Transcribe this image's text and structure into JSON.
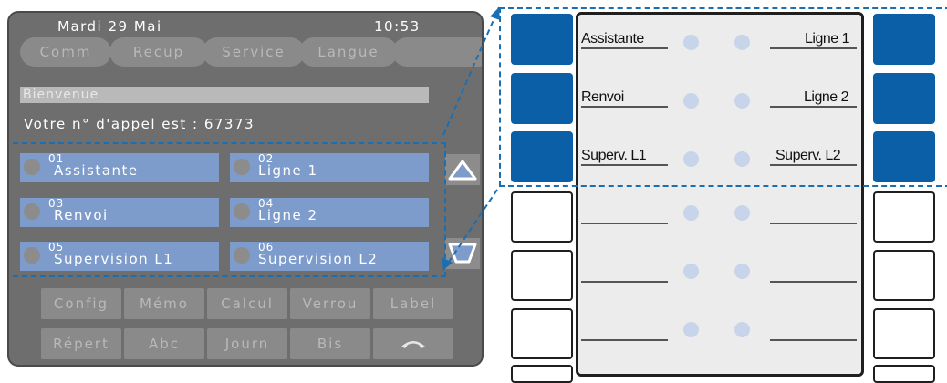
{
  "header": {
    "date": "Mardi 29 Mai",
    "time": "10:53"
  },
  "softkeys": [
    "Comm",
    "Recup",
    "Service",
    "Langue",
    ""
  ],
  "welcome": "Bienvenue",
  "call_number_text": "Votre n° d'appel est : 67373",
  "prog_keys": [
    {
      "num": "01",
      "label": "Assistante"
    },
    {
      "num": "02",
      "label": "Ligne 1"
    },
    {
      "num": "03",
      "label": "Renvoi"
    },
    {
      "num": "04",
      "label": "Ligne 2"
    },
    {
      "num": "05",
      "label": "Supervision L1"
    },
    {
      "num": "06",
      "label": "Supervision L2"
    }
  ],
  "function_keys_row1": [
    "Config",
    "Mémo",
    "Calcul",
    "Verrou",
    "Label"
  ],
  "function_keys_row2": [
    "Répert",
    "Abc",
    "Journ",
    "Bis",
    ""
  ],
  "module": {
    "left_labels": [
      "Assistante",
      "Renvoi",
      "Superv. L1"
    ],
    "right_labels": [
      "Ligne 1",
      "Ligne 2",
      "Superv. L2"
    ]
  },
  "icons": [
    "arrow-up-icon",
    "arrow-down-icon",
    "hang-up-icon"
  ],
  "colors": {
    "lcd_bg": "#6e6e6e",
    "prog_key": "#7d9bcb",
    "module_blue": "#0a5fa7",
    "dashed": "#1a6fb3"
  }
}
